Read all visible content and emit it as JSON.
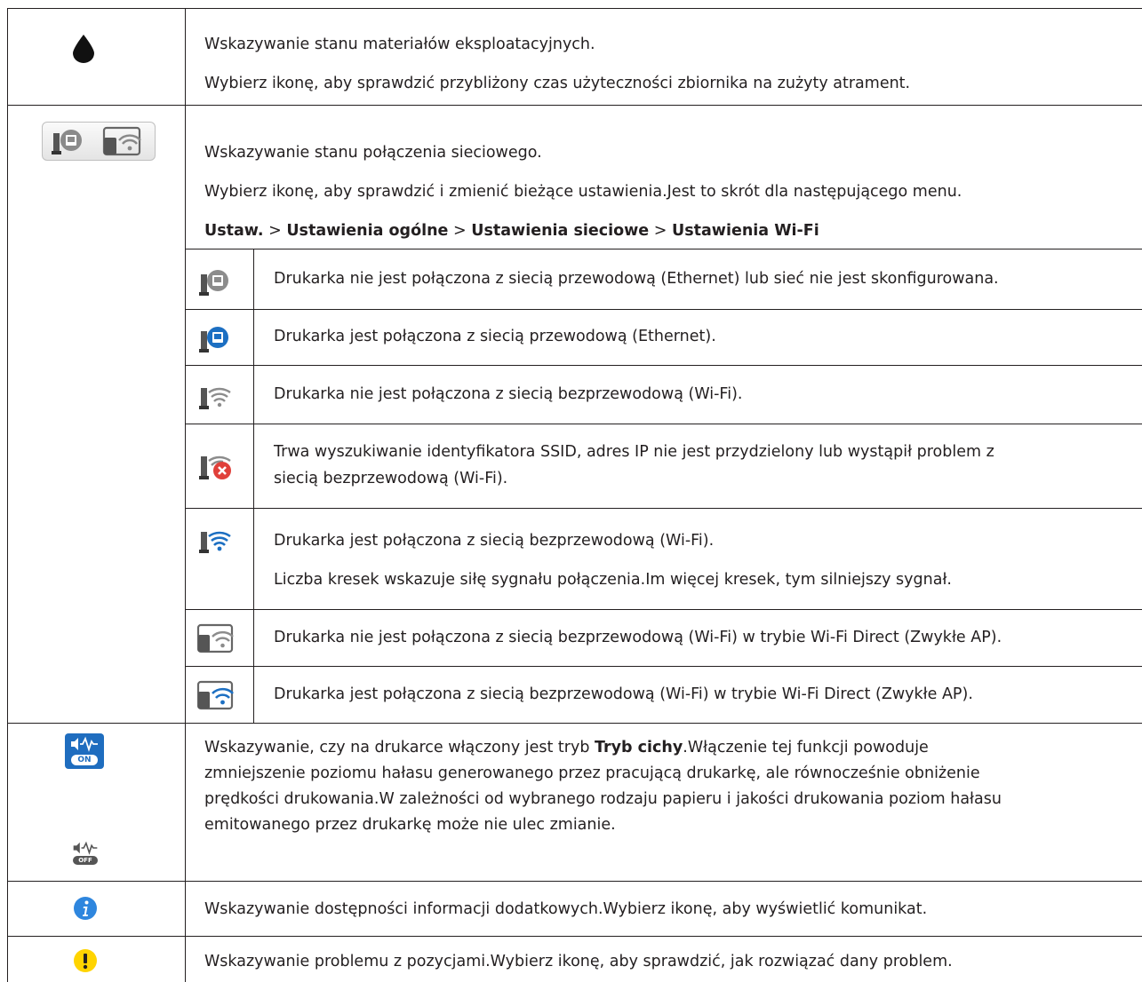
{
  "ink_row": {
    "icon": "ink-drop-icon",
    "line1": "Wskazywanie stanu materiałów eksploatacyjnych.",
    "line2": "Wybierz ikonę, aby sprawdzić przybliżony czas użyteczności zbiornika na zużyty atrament."
  },
  "network_row": {
    "icon": "network-status-icon",
    "line1": "Wskazywanie stanu połączenia sieciowego.",
    "line2": "Wybierz ikonę, aby sprawdzić i zmienić bieżące ustawienia.Jest to skrót dla następującego menu.",
    "menu_path": [
      "Ustaw.",
      "Ustawienia ogólne",
      "Ustawienia sieciowe",
      "Ustawienia Wi-Fi"
    ],
    "separator": ">",
    "sub_rows": [
      {
        "icon": "ethernet-disconnected-icon",
        "text": "Drukarka nie jest połączona z siecią przewodową (Ethernet) lub sieć nie jest skonfigurowana."
      },
      {
        "icon": "ethernet-connected-icon",
        "text": "Drukarka jest połączona z siecią przewodową (Ethernet)."
      },
      {
        "icon": "wifi-disconnected-icon",
        "text": "Drukarka nie jest połączona z siecią bezprzewodową (Wi-Fi)."
      },
      {
        "icon": "wifi-error-icon",
        "text_line1": "Trwa wyszukiwanie identyfikatora SSID, adres IP nie jest przydzielony lub wystąpił problem z",
        "text_line2": "siecią bezprzewodową (Wi-Fi)."
      },
      {
        "icon": "wifi-connected-icon",
        "text": "Drukarka jest połączona z siecią bezprzewodową (Wi-Fi).",
        "text2": "Liczba kresek wskazuje siłę sygnału połączenia.Im więcej kresek, tym silniejszy sygnał."
      },
      {
        "icon": "wifi-direct-disconnected-icon",
        "text": "Drukarka nie jest połączona z siecią bezprzewodową (Wi-Fi) w trybie Wi-Fi Direct (Zwykłe AP)."
      },
      {
        "icon": "wifi-direct-connected-icon",
        "text": "Drukarka jest połączona z siecią bezprzewodową (Wi-Fi) w trybie Wi-Fi Direct (Zwykłe AP)."
      }
    ]
  },
  "quiet_row": {
    "icon_on": "quiet-mode-on-icon",
    "icon_off": "quiet-mode-off-icon",
    "on_label": "ON",
    "off_label": "OFF",
    "pre": "Wskazywanie, czy na drukarce włączony jest tryb ",
    "bold": "Tryb cichy",
    "rest_1": ".Włączenie tej funkcji powoduje",
    "line2": "zmniejszenie poziomu hałasu generowanego przez pracującą drukarkę, ale równocześnie obniżenie",
    "line3": "prędkości drukowania.W zależności od wybranego rodzaju papieru i jakości drukowania poziom hałasu",
    "line4": "emitowanego przez drukarkę może nie ulec zmianie."
  },
  "info_row": {
    "icon": "info-icon",
    "text": "Wskazywanie dostępności informacji dodatkowych.Wybierz ikonę, aby wyświetlić komunikat."
  },
  "alert_row": {
    "icon": "alert-icon",
    "text": "Wskazywanie problemu z pozycjami.Wybierz ikonę, aby sprawdzić, jak rozwiązać dany problem."
  },
  "colors": {
    "text": "#231f20",
    "accent_blue": "#1c6fc2",
    "info_blue": "#2e86de",
    "alert_yellow": "#ffd400"
  }
}
